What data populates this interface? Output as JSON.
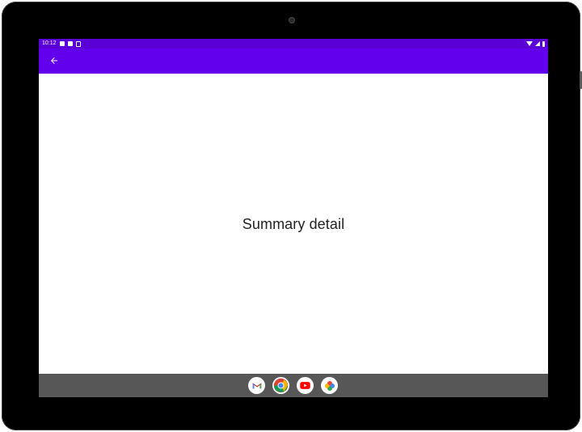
{
  "status_bar": {
    "time": "10:12"
  },
  "app_bar": {
    "back_icon": "arrow-left-icon"
  },
  "content": {
    "summary_text": "Summary detail"
  },
  "dock": {
    "apps": [
      {
        "name": "Gmail",
        "icon": "gmail-icon"
      },
      {
        "name": "Chrome",
        "icon": "chrome-icon"
      },
      {
        "name": "YouTube",
        "icon": "youtube-icon"
      },
      {
        "name": "Photos",
        "icon": "photos-icon"
      }
    ]
  },
  "colors": {
    "status_bar": "#5a00d6",
    "app_bar": "#6200ee",
    "nav_bar": "#575757",
    "device_frame": "#000000",
    "text": "#222222"
  }
}
